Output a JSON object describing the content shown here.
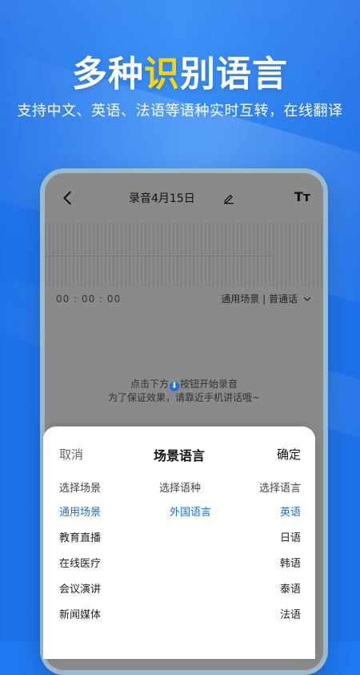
{
  "hero": {
    "title_part1": "多种",
    "title_highlight": "识",
    "title_part2": "别语言",
    "subtitle": "支持中文、英语、法语等语种实时互转，在线翻译"
  },
  "recorder": {
    "title": "录音4月15日",
    "time": "00 : 00 : 00",
    "scene_selector": "通用场景 | 普通话",
    "hint_line1_before": "点击下方",
    "hint_line1_after": "按钮开始录音",
    "hint_line2": "为了保证效果，请靠近手机讲话哦~",
    "font_toggle": "Tт",
    "mic_badge": "⬇"
  },
  "sheet": {
    "cancel": "取消",
    "title": "场景语言",
    "confirm": "确定",
    "headers": [
      "选择场景",
      "选择语种",
      "选择语言"
    ],
    "selected": [
      "通用场景",
      "外国语言",
      "英语"
    ],
    "scenes": [
      "教育直播",
      "在线医疗",
      "会议演讲",
      "新闻媒体"
    ],
    "languages": [
      "日语",
      "韩语",
      "泰语",
      "法语"
    ]
  },
  "colors": {
    "accent": "#1f6fe3",
    "hero_highlight": "#ffd400",
    "background_blue": "#1f78f0"
  },
  "icons": {
    "back": "back-arrow-icon",
    "edit": "edit-pencil-icon",
    "font": "font-size-icon",
    "dropdown": "chevron-down-icon",
    "mic": "mic-icon"
  }
}
